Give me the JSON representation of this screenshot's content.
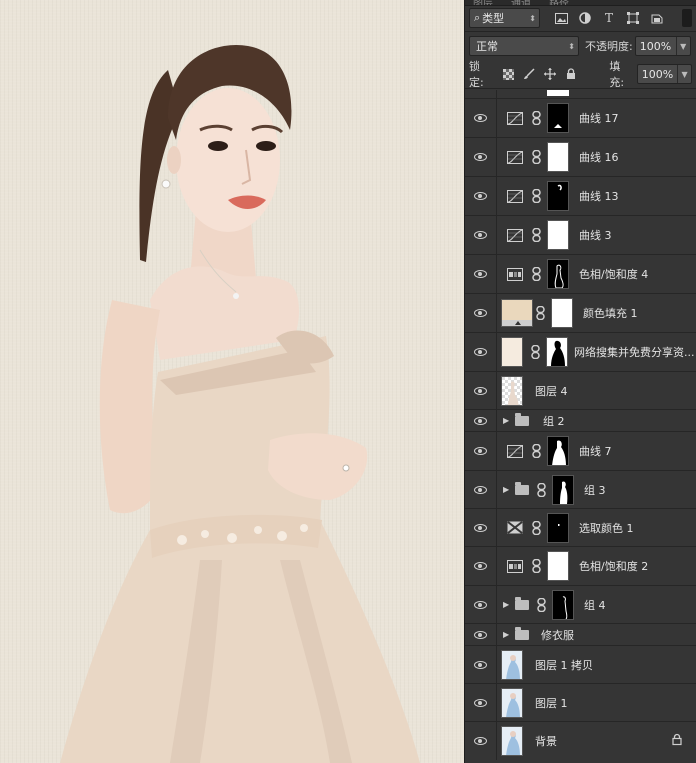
{
  "panel": {
    "tabs": [
      "图层",
      "通道",
      "路径"
    ],
    "filter": {
      "kind_label": "类型"
    },
    "blend": {
      "mode": "正常",
      "opacity_label": "不透明度:",
      "opacity_value": "100%"
    },
    "lock": {
      "label": "锁定:",
      "fill_label": "填充:",
      "fill_value": "100%"
    }
  },
  "layers": [
    {
      "name": "曲线 17",
      "type": "curves",
      "mask": "black"
    },
    {
      "name": "曲线 16",
      "type": "curves",
      "mask": "white"
    },
    {
      "name": "曲线 13",
      "type": "curves",
      "mask": "black"
    },
    {
      "name": "曲线 3",
      "type": "curves",
      "mask": "white"
    },
    {
      "name": "色相/饱和度 4",
      "type": "hue",
      "mask": "black"
    },
    {
      "name": "颜色填充 1",
      "type": "fill",
      "mask": "white"
    },
    {
      "name": "网络搜集并免费分享资...",
      "type": "image",
      "mask": "black"
    },
    {
      "name": "图层 4",
      "type": "image"
    },
    {
      "name": "组 2",
      "type": "group"
    },
    {
      "name": "曲线 7",
      "type": "curves",
      "mask": "black"
    },
    {
      "name": "组 3",
      "type": "group",
      "mask": "black"
    },
    {
      "name": "选取颜色 1",
      "type": "selective",
      "mask": "black"
    },
    {
      "name": "色相/饱和度 2",
      "type": "hue",
      "mask": "white"
    },
    {
      "name": "组 4",
      "type": "group",
      "mask": "black"
    },
    {
      "name": "修衣服",
      "type": "group"
    },
    {
      "name": "图层 1 拷贝",
      "type": "image"
    },
    {
      "name": "图层 1",
      "type": "image"
    },
    {
      "name": "背景",
      "type": "image",
      "locked": true
    }
  ],
  "colors": {
    "panel_bg": "#353535",
    "canvas_bg": "#eae4d8",
    "dress": "#e9d7c5",
    "fill_swatch": "#ead8bd"
  }
}
